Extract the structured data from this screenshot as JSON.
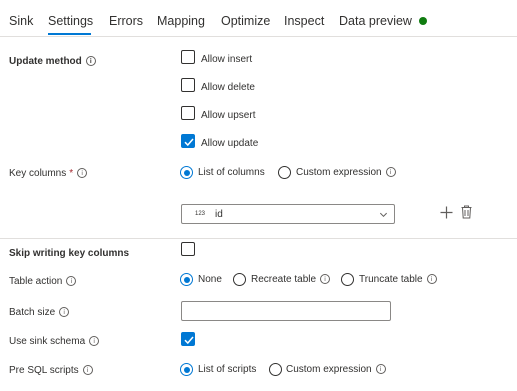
{
  "tabs": [
    {
      "label": "Sink"
    },
    {
      "label": "Settings"
    },
    {
      "label": "Errors"
    },
    {
      "label": "Mapping"
    },
    {
      "label": "Optimize"
    },
    {
      "label": "Inspect"
    },
    {
      "label": "Data preview"
    }
  ],
  "active_tab": "Settings",
  "status_dot_color": "#107c10",
  "accent_color": "#0078d4",
  "update_method": {
    "label": "Update method",
    "info_icon": "info-icon",
    "options": [
      {
        "label": "Allow insert",
        "checked": false
      },
      {
        "label": "Allow delete",
        "checked": false
      },
      {
        "label": "Allow upsert",
        "checked": false
      },
      {
        "label": "Allow update",
        "checked": true
      }
    ]
  },
  "key_columns": {
    "label": "Key columns",
    "required_marker": "*",
    "options": [
      {
        "label": "List of columns",
        "selected": true
      },
      {
        "label": "Custom expression",
        "selected": false
      }
    ],
    "column_type_badge": "123",
    "selected_column": "id"
  },
  "skip_writing_key_columns": {
    "label": "Skip writing key columns",
    "checked": false
  },
  "table_action": {
    "label": "Table action",
    "options": [
      {
        "label": "None",
        "selected": true
      },
      {
        "label": "Recreate table",
        "selected": false
      },
      {
        "label": "Truncate table",
        "selected": false
      }
    ]
  },
  "batch_size": {
    "label": "Batch size",
    "value": ""
  },
  "use_sink_schema": {
    "label": "Use sink schema",
    "checked": true
  },
  "pre_sql_scripts": {
    "label": "Pre SQL scripts",
    "options": [
      {
        "label": "List of scripts",
        "selected": true
      },
      {
        "label": "Custom expression",
        "selected": false
      }
    ]
  },
  "info_glyph": "i"
}
